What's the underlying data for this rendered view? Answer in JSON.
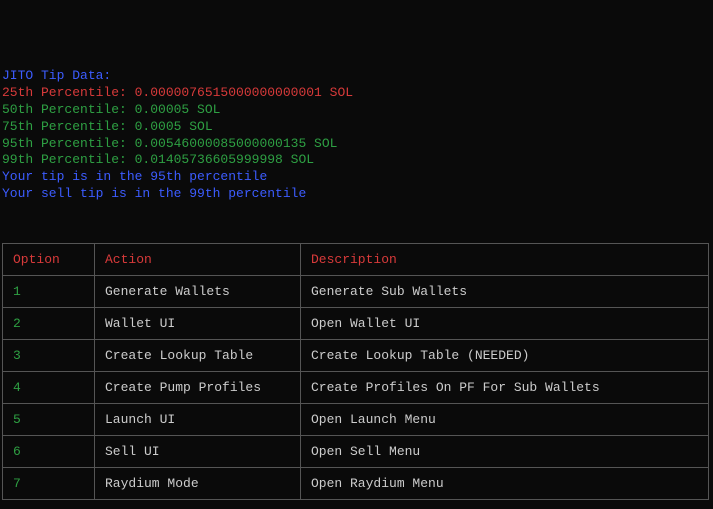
{
  "tip_data": {
    "header": "JITO Tip Data:",
    "p25": "25th Percentile: 0.0000076515000000000001 SOL",
    "p50": "50th Percentile: 0.00005 SOL",
    "p75": "75th Percentile: 0.0005 SOL",
    "p95": "95th Percentile: 0.00546000085000000135 SOL",
    "p99": "99th Percentile: 0.01405736605999998 SOL",
    "your_tip": "Your tip is in the 95th percentile",
    "your_sell_tip": "Your sell tip is in the 99th percentile"
  },
  "table": {
    "headers": {
      "option": "Option",
      "action": "Action",
      "description": "Description"
    },
    "rows": [
      {
        "option": "1",
        "action": "Generate Wallets",
        "description": "Generate Sub Wallets"
      },
      {
        "option": "2",
        "action": "Wallet UI",
        "description": "Open Wallet UI"
      },
      {
        "option": "3",
        "action": "Create Lookup Table",
        "description": "Create Lookup Table (NEEDED)"
      },
      {
        "option": "4",
        "action": "Create Pump Profiles",
        "description": "Create Profiles On PF For Sub Wallets"
      },
      {
        "option": "5",
        "action": " Launch UI",
        "description": "Open Launch Menu"
      },
      {
        "option": "6",
        "action": "Sell UI",
        "description": "Open Sell Menu"
      },
      {
        "option": "7",
        "action": "Raydium Mode",
        "description": "Open Raydium Menu"
      }
    ]
  }
}
